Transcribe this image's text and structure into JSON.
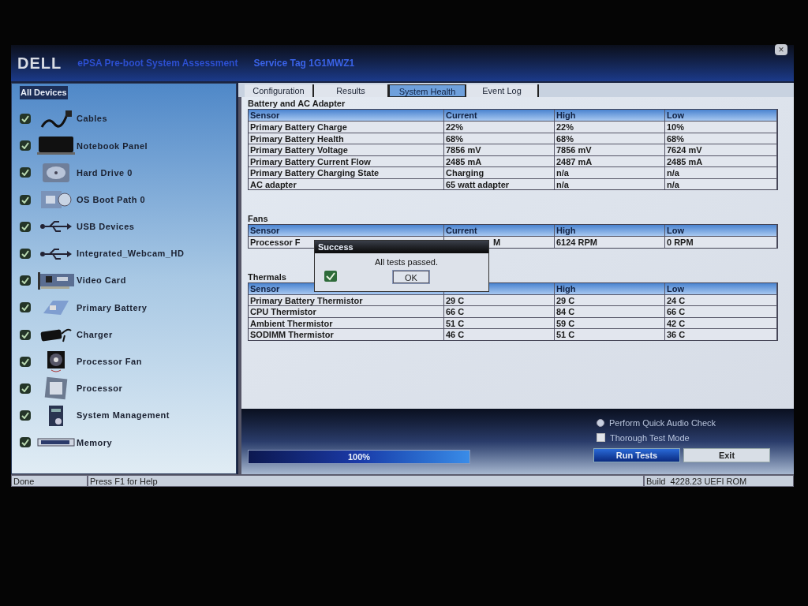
{
  "window": {
    "logo": "DELL",
    "title": "ePSA Pre-boot System Assessment",
    "service_tag": "Service Tag 1G1MWZ1",
    "close": "×"
  },
  "sidebar": {
    "title": "All Devices",
    "items": [
      {
        "label": "Cables",
        "checked": true
      },
      {
        "label": "Notebook Panel",
        "checked": true
      },
      {
        "label": "Hard Drive 0",
        "checked": true
      },
      {
        "label": "OS Boot Path 0",
        "checked": true
      },
      {
        "label": "USB Devices",
        "checked": true
      },
      {
        "label": "Integrated_Webcam_HD",
        "checked": true
      },
      {
        "label": "Video Card",
        "checked": true
      },
      {
        "label": "Primary Battery",
        "checked": true
      },
      {
        "label": "Charger",
        "checked": true
      },
      {
        "label": "Processor Fan",
        "checked": true
      },
      {
        "label": "Processor",
        "checked": true
      },
      {
        "label": "System Management",
        "checked": true
      },
      {
        "label": "Memory",
        "checked": true
      }
    ]
  },
  "tabs": [
    {
      "label": "Configuration",
      "selected": false
    },
    {
      "label": "Results",
      "selected": false
    },
    {
      "label": "System Health",
      "selected": true
    },
    {
      "label": "Event Log",
      "selected": false
    }
  ],
  "sections": [
    {
      "title": "Battery and AC Adapter",
      "columns": [
        "Sensor",
        "Current",
        "High",
        "Low"
      ],
      "rows": [
        [
          "Primary Battery Charge",
          "22%",
          "22%",
          "10%"
        ],
        [
          "Primary Battery Health",
          "68%",
          "68%",
          "68%"
        ],
        [
          "Primary Battery Voltage",
          "7856 mV",
          "7856 mV",
          "7624 mV"
        ],
        [
          "Primary Battery Current Flow",
          "2485 mA",
          "2487 mA",
          "2485 mA"
        ],
        [
          "Primary Battery Charging State",
          "Charging",
          "n/a",
          "n/a"
        ],
        [
          "AC adapter",
          "65 watt adapter",
          "n/a",
          "n/a"
        ]
      ]
    },
    {
      "title": "Fans",
      "columns": [
        "Sensor",
        "Current",
        "High",
        "Low"
      ],
      "rows": [
        [
          "Processor F",
          "M",
          "6124 RPM",
          "0 RPM"
        ]
      ]
    },
    {
      "title": "Thermals",
      "columns": [
        "Sensor",
        null,
        "High",
        "Low"
      ],
      "rows": [
        [
          "Primary Battery Thermistor",
          "29 C",
          "29 C",
          "24 C"
        ],
        [
          "CPU Thermistor",
          "66 C",
          "84 C",
          "66 C"
        ],
        [
          "Ambient Thermistor",
          "51 C",
          "59 C",
          "42 C"
        ],
        [
          "SODIMM Thermistor",
          "46 C",
          "51 C",
          "36 C"
        ]
      ]
    }
  ],
  "dialog": {
    "title": "Success",
    "message": "All tests passed.",
    "button": "OK"
  },
  "options": [
    {
      "kind": "radio",
      "label": "Perform Quick Audio Check",
      "selected": true
    },
    {
      "kind": "checkbox",
      "label": "Thorough Test Mode",
      "checked": false
    }
  ],
  "progress": {
    "level": 1,
    "label": "100%"
  },
  "buttons": [
    {
      "label": "Run Tests",
      "primary": true
    },
    {
      "label": "Exit",
      "primary": false
    }
  ],
  "status_bar": [
    "Done",
    "Press F1 for Help",
    "Build  4228.23 UEFI ROM"
  ]
}
